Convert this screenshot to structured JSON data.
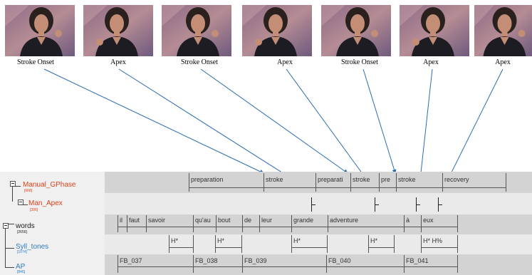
{
  "frames": [
    {
      "caption": "Stroke Onset"
    },
    {
      "caption": "Apex"
    },
    {
      "caption": "Stroke Onset"
    },
    {
      "caption": "Apex"
    },
    {
      "caption": "Stroke Onset"
    },
    {
      "caption": "Apex"
    },
    {
      "caption": "Apex"
    }
  ],
  "colors": {
    "tier_red": "#e0401c",
    "tier_blue": "#2e7bc2",
    "arrow": "#2b6cb0",
    "panel": "#d9d9d9"
  },
  "tiers": [
    {
      "name": "Manual_GPhase",
      "count": "[668]",
      "color": "red",
      "segments": [
        "preparation",
        "stroke",
        "preparati",
        "stroke",
        "pre",
        "stroke",
        "recovery"
      ]
    },
    {
      "name": "Man_Apex",
      "count": "[395]",
      "color": "red",
      "segments": []
    },
    {
      "name": "words",
      "count": "[2656]",
      "color": "dark",
      "segments": [
        "il",
        "faut",
        "savoir",
        "qu'au",
        "bout",
        "de",
        "leur",
        "grande",
        "adventure",
        "à",
        "eux"
      ]
    },
    {
      "name": "Syll_tones",
      "count": "[1074]",
      "color": "blue",
      "segments": [
        "H*",
        "H*",
        "H*",
        "H*",
        "H* H%"
      ]
    },
    {
      "name": "AP",
      "count": "[846]",
      "color": "blue",
      "segments": [
        "FB_037",
        "FB_038",
        "FB_039",
        "FB_040",
        "FB_041"
      ]
    }
  ]
}
